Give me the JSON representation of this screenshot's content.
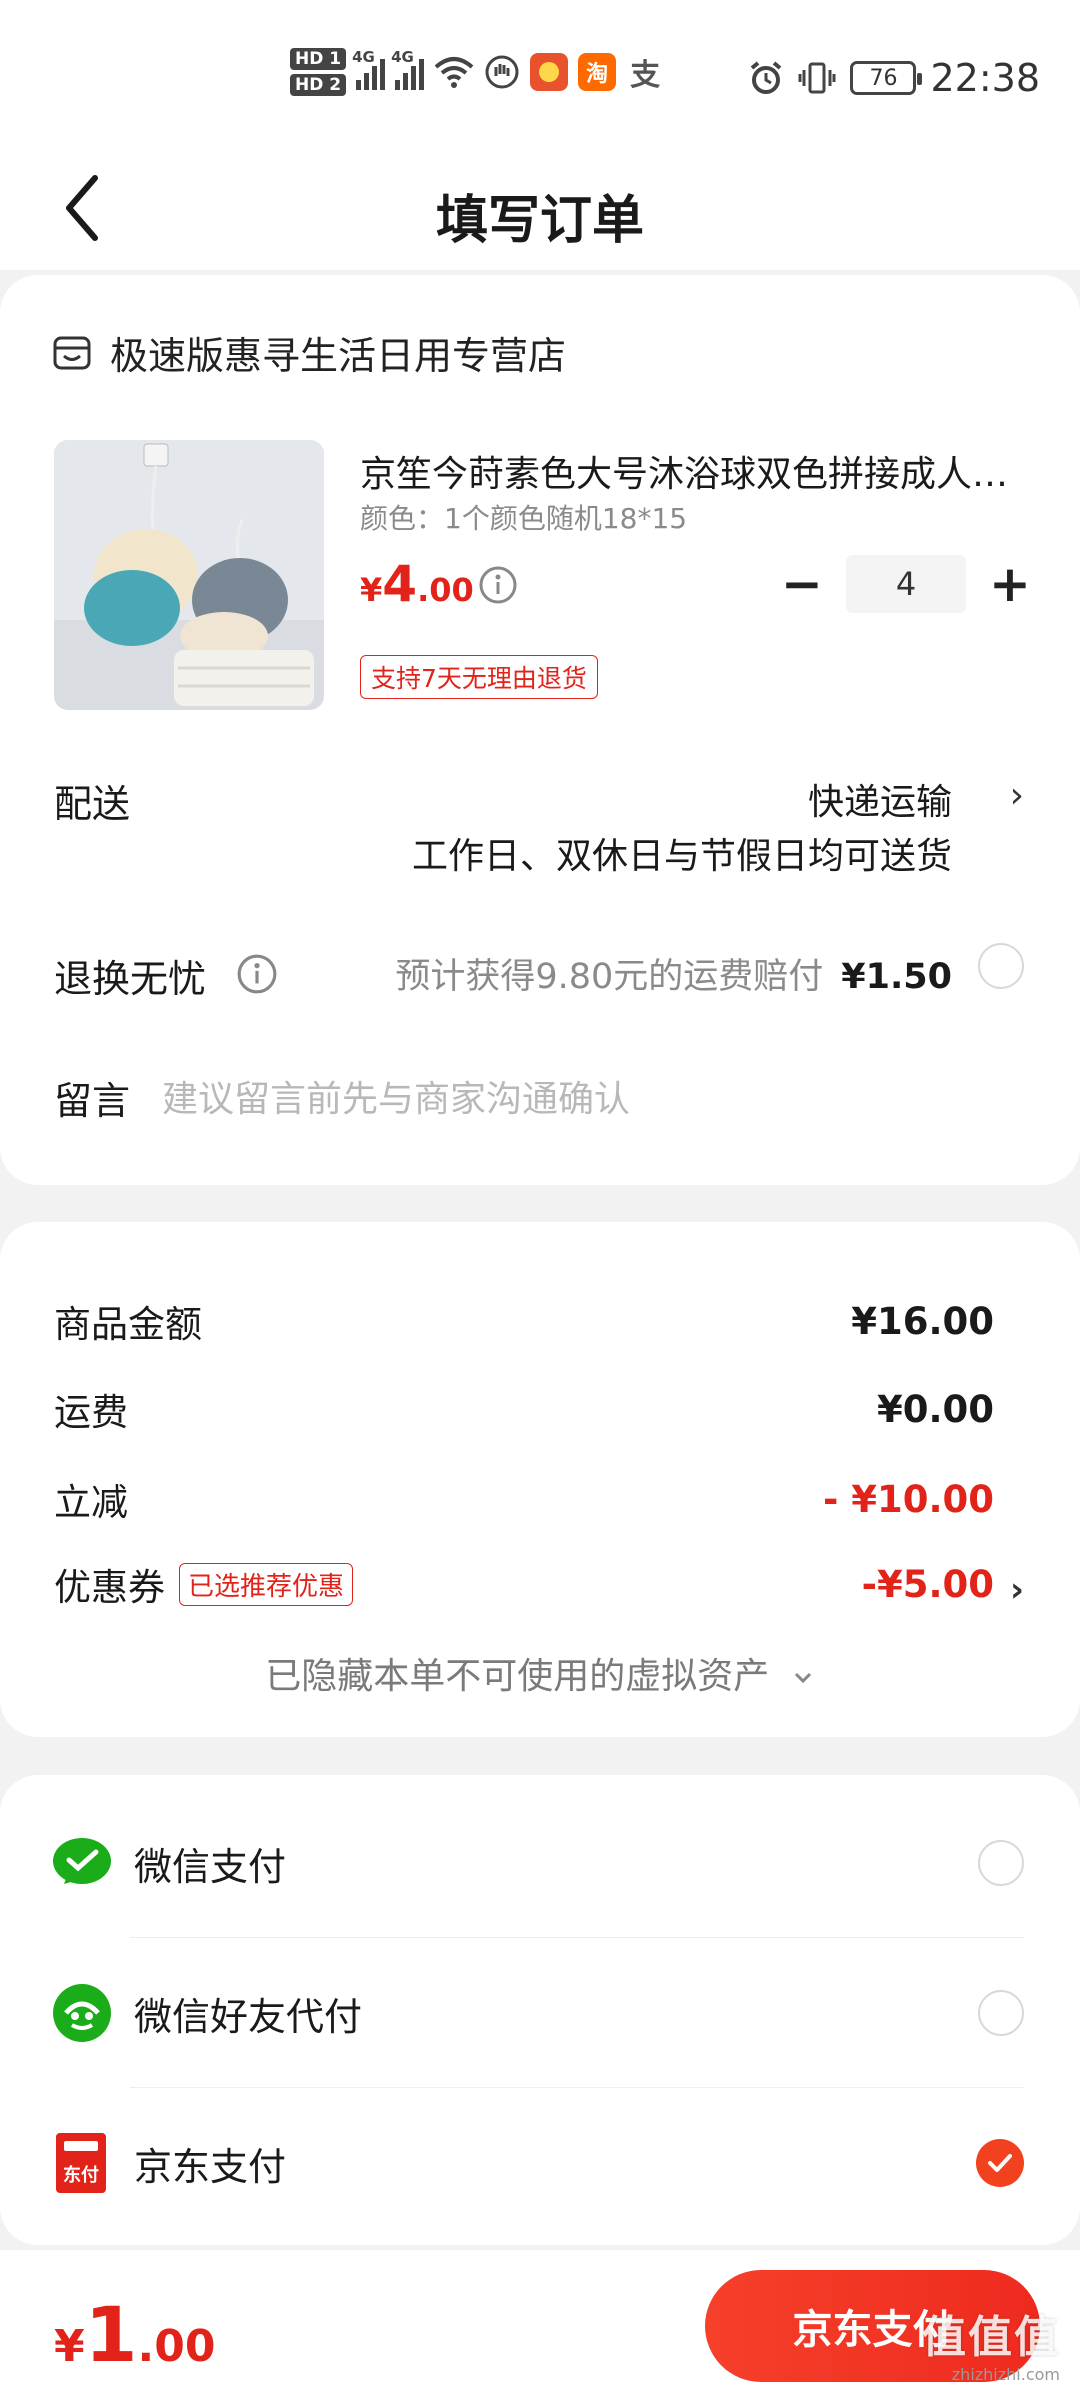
{
  "status_bar": {
    "hd1": "HD 1",
    "hd2": "HD 2",
    "net1": "4G",
    "net2": "4G",
    "app_icon_taobao": "淘",
    "app_icon_alipay": "支",
    "battery": "76",
    "time": "22:38"
  },
  "nav": {
    "title": "填写订单"
  },
  "store": {
    "name": "极速版惠寻生活日用专营店"
  },
  "product": {
    "title": "京笙今莳素色大号沐浴球双色拼接成人儿童洗澡海绵搓背浴花",
    "spec": "颜色：1个颜色随机18*15",
    "price_currency": "¥",
    "price_int": "4",
    "price_dec": ".00",
    "quantity": "4",
    "minus_label": "−",
    "plus_label": "+",
    "return_tag": "支持7天无理由退货"
  },
  "delivery": {
    "label": "配送",
    "method": "快递运输",
    "note": "工作日、双休日与节假日均可送货"
  },
  "worry_free": {
    "label": "退换无忧",
    "desc": "预计获得9.80元的运费赔付",
    "price": "¥1.50"
  },
  "message": {
    "label": "留言",
    "placeholder": "建议留言前先与商家沟通确认"
  },
  "summary": {
    "goods_label": "商品金额",
    "goods_value": "¥16.00",
    "shipping_label": "运费",
    "shipping_value": "¥0.00",
    "discount_label": "立减",
    "discount_value": "- ¥10.00",
    "coupon_label": "优惠券",
    "coupon_tag": "已选推荐优惠",
    "coupon_value": "-¥5.00",
    "hidden_assets": "已隐藏本单不可使用的虚拟资产"
  },
  "payment": {
    "options": [
      {
        "label": "微信支付",
        "selected": false
      },
      {
        "label": "微信好友代付",
        "selected": false
      },
      {
        "label": "京东支付",
        "selected": true
      }
    ],
    "jd_icon_text": "东付"
  },
  "bottom": {
    "total_currency": "¥",
    "total_int": "1",
    "total_dec": ".00",
    "pay_button": "京东支付",
    "watermark_big": "值值值",
    "watermark_small": "zhizhizhi.com"
  },
  "colors": {
    "accent": "#e2231a",
    "pay_button": "#f2411f",
    "wechat_green": "#1aad19"
  }
}
